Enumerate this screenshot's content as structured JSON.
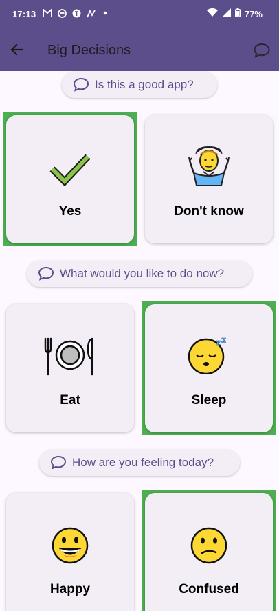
{
  "status": {
    "time": "17:13",
    "battery": "77%"
  },
  "appbar": {
    "title": "Big Decisions"
  },
  "questions": [
    {
      "text": "Is this a good app?",
      "options": [
        {
          "label": "Yes",
          "icon": "check-mark-icon",
          "selected": true
        },
        {
          "label": "Don't know",
          "icon": "person-shrugging-icon",
          "selected": false
        }
      ]
    },
    {
      "text": "What would you like to do now?",
      "options": [
        {
          "label": "Eat",
          "icon": "plate-fork-knife-icon",
          "selected": false
        },
        {
          "label": "Sleep",
          "icon": "sleeping-face-icon",
          "selected": true
        }
      ]
    },
    {
      "text": "How are you feeling today?",
      "options": [
        {
          "label": "Happy",
          "icon": "grinning-face-icon",
          "selected": false
        },
        {
          "label": "Confused",
          "icon": "confused-face-icon",
          "selected": true
        }
      ]
    }
  ],
  "colors": {
    "appbar": "#5b4e8a",
    "selected": "#4caf50",
    "card": "#f3eef6",
    "background": "#fdf7ff"
  }
}
